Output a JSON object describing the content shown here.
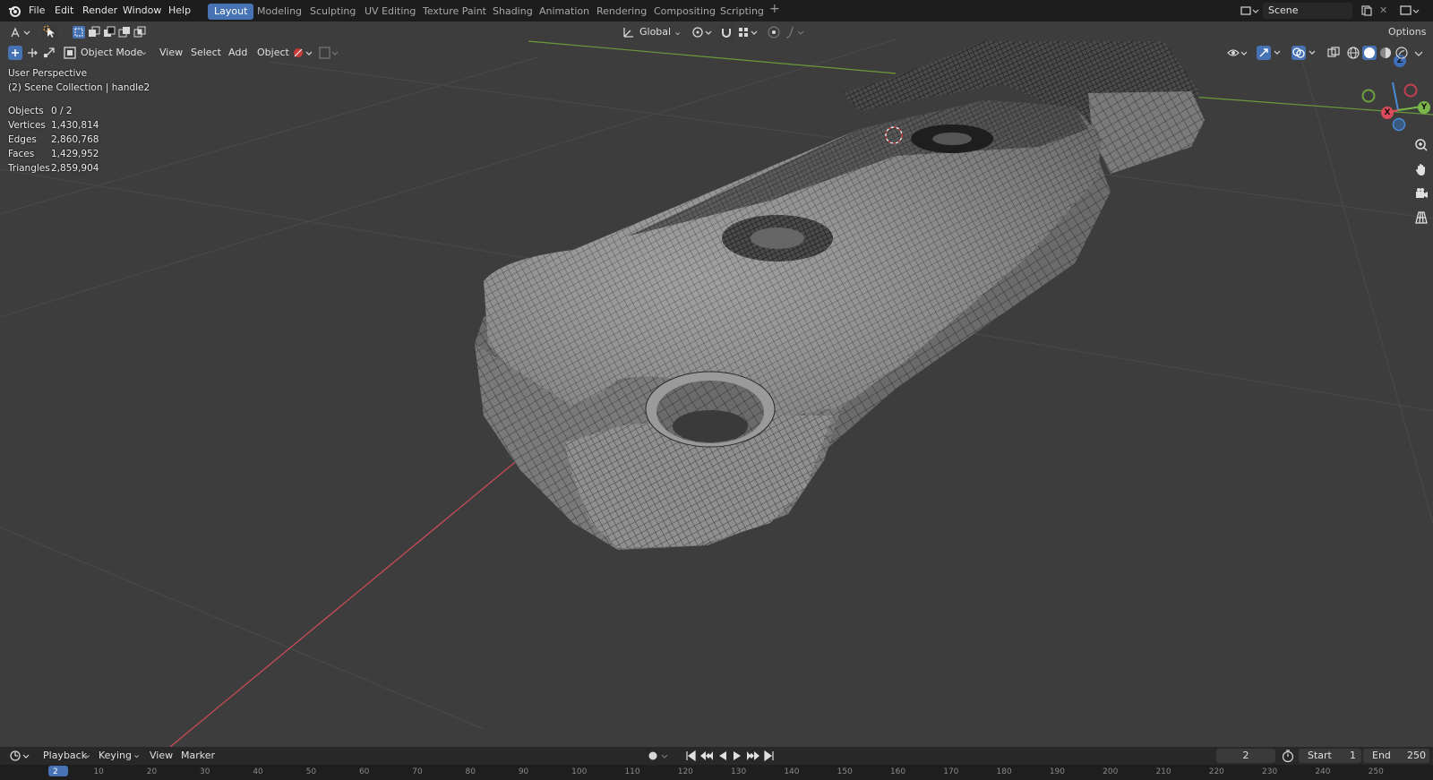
{
  "menu": [
    "File",
    "Edit",
    "Render",
    "Window",
    "Help"
  ],
  "workspaces": [
    "Layout",
    "Modeling",
    "Sculpting",
    "UV Editing",
    "Texture Paint",
    "Shading",
    "Animation",
    "Rendering",
    "Compositing",
    "Scripting"
  ],
  "active_workspace": "Layout",
  "scene_name": "Scene",
  "tool_header": {
    "orientation": "Global",
    "options_label": "Options"
  },
  "viewport_header": {
    "mode": "Object Mode",
    "view": "View",
    "select": "Select",
    "add": "Add",
    "object": "Object"
  },
  "overlay": {
    "perspective": "User Perspective",
    "collection": "(2) Scene Collection | handle2"
  },
  "stats": [
    {
      "label": "Objects",
      "value": "0 / 2"
    },
    {
      "label": "Vertices",
      "value": "1,430,814"
    },
    {
      "label": "Edges",
      "value": "2,860,768"
    },
    {
      "label": "Faces",
      "value": "1,429,952"
    },
    {
      "label": "Triangles",
      "value": "2,859,904"
    }
  ],
  "gizmo_axes": {
    "z": "Z",
    "y": "Y",
    "x": "X"
  },
  "timeline": {
    "playback": "Playback",
    "keying": "Keying",
    "view": "View",
    "marker": "Marker",
    "current_frame": "2",
    "start_label": "Start",
    "start_value": "1",
    "end_label": "End",
    "end_value": "250",
    "ruler_ticks": [
      "2",
      "10",
      "20",
      "30",
      "40",
      "50",
      "60",
      "70",
      "80",
      "90",
      "100",
      "110",
      "120",
      "130",
      "140",
      "150",
      "160",
      "170",
      "180",
      "190",
      "200",
      "210",
      "220",
      "230",
      "240",
      "250"
    ]
  },
  "colors": {
    "accent": "#4772b3",
    "viewport_bg": "#3d3d3d",
    "x_axis": "#d94a5a",
    "y_axis": "#7ab64a",
    "z_axis": "#4a8ad9"
  }
}
